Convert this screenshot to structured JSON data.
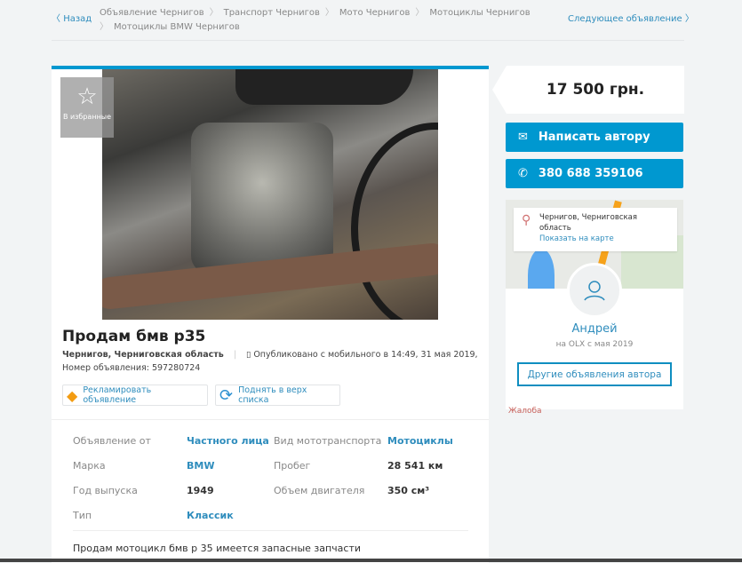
{
  "nav": {
    "back": "Назад",
    "next": "Следующее объявление",
    "breadcrumbs": [
      "Объявление Чернигов",
      "Транспорт Чернигов",
      "Мото Чернигов",
      "Мотоциклы Чернигов",
      "Мотоциклы BMW Чернигов"
    ]
  },
  "ad": {
    "favorite": "В избранные",
    "title": "Продам бмв р35",
    "location": "Чернигов, Черниговская область",
    "published": "Опубликовано с мобильного  в 14:49, 31 мая 2019,",
    "ad_number": "Номер объявления: 597280724",
    "promote": "Рекламировать объявление",
    "raise": "Поднять в верх списка",
    "params": [
      {
        "k1": "Объявление от",
        "v1": "Частного лица",
        "k2": "Вид мототранспорта",
        "v2": "Мотоциклы"
      },
      {
        "k1": "Марка",
        "v1": "BMW",
        "k2": "Пробег",
        "v2": "28 541 км"
      },
      {
        "k1": "Год выпуска",
        "v1": "1949",
        "k2": "Объем двигателя",
        "v2": "350 см³"
      },
      {
        "k1": "Тип",
        "v1": "Классик",
        "k2": "",
        "v2": ""
      }
    ],
    "description": "Продам мотоцикл бмв р 35 имеется запасные запчасти"
  },
  "sidebar": {
    "price": "17 500 грн.",
    "write": "Написать автору",
    "phone": "380 688 359106",
    "map_location": "Чернигов, Черниговская область",
    "show_map": "Показать на карте",
    "seller": "Андрей",
    "since": "на OLX с мая 2019",
    "other_ads": "Другие объявления автора",
    "complaint": "Жалоба"
  },
  "colors": {
    "accent": "#0098d0",
    "link": "#2f8dbd",
    "complaint": "#c8605a"
  }
}
